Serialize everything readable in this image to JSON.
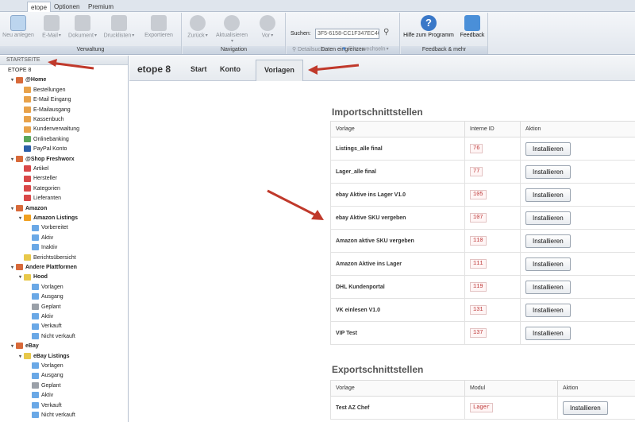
{
  "ribbon_tabs": [
    {
      "label": "etope",
      "active": true
    },
    {
      "label": "Optionen",
      "active": false
    },
    {
      "label": "Premium",
      "active": false
    }
  ],
  "ribbon": {
    "groups": {
      "verwaltung": "Verwaltung",
      "navigation": "Navigation",
      "daten": "Daten eingrenzen",
      "feedback": "Feedback & mehr"
    },
    "buttons": {
      "neu": "Neu anlegen",
      "email": "E-Mail",
      "dokument": "Dokument",
      "druck": "Drucklisten",
      "export": "Exportieren",
      "zurueck": "Zurück",
      "aktual": "Aktualisieren",
      "vor": "Vor",
      "hilfe": "Hilfe zum Programm",
      "feedback": "Feedback"
    },
    "search_label": "Suchen:",
    "search_value": "3F5-6158-CC1F347EC400",
    "detail": "Detailsuche",
    "filter": "Filter wechseln"
  },
  "sidebar": {
    "header": "STARTSEITE",
    "nodes": [
      {
        "label": "ETOPE 8",
        "depth": 0,
        "twisty": "",
        "icon": "",
        "bold": false
      },
      {
        "label": "@Home",
        "depth": 1,
        "twisty": "▾",
        "icon": "house",
        "bold": true
      },
      {
        "label": "Bestellungen",
        "depth": 2,
        "twisty": "",
        "icon": "orange",
        "bold": false
      },
      {
        "label": "E-Mail Eingang",
        "depth": 2,
        "twisty": "",
        "icon": "orange",
        "bold": false
      },
      {
        "label": "E-Mailausgang",
        "depth": 2,
        "twisty": "",
        "icon": "orange",
        "bold": false
      },
      {
        "label": "Kassenbuch",
        "depth": 2,
        "twisty": "",
        "icon": "orange",
        "bold": false
      },
      {
        "label": "Kundenverwaltung",
        "depth": 2,
        "twisty": "",
        "icon": "orange",
        "bold": false
      },
      {
        "label": "Onlinebanking",
        "depth": 2,
        "twisty": "",
        "icon": "green",
        "bold": false
      },
      {
        "label": "PayPal Konto",
        "depth": 2,
        "twisty": "",
        "icon": "pp",
        "bold": false
      },
      {
        "label": "@Shop Freshworx",
        "depth": 1,
        "twisty": "▾",
        "icon": "house",
        "bold": true
      },
      {
        "label": "Artikel",
        "depth": 2,
        "twisty": "",
        "icon": "red",
        "bold": false
      },
      {
        "label": "Hersteller",
        "depth": 2,
        "twisty": "",
        "icon": "red",
        "bold": false
      },
      {
        "label": "Kategorien",
        "depth": 2,
        "twisty": "",
        "icon": "red",
        "bold": false
      },
      {
        "label": "Lieferanten",
        "depth": 2,
        "twisty": "",
        "icon": "red",
        "bold": false
      },
      {
        "label": "Amazon",
        "depth": 1,
        "twisty": "▾",
        "icon": "house",
        "bold": true
      },
      {
        "label": "Amazon Listings",
        "depth": 2,
        "twisty": "▾",
        "icon": "amz",
        "bold": true
      },
      {
        "label": "Vorbereitet",
        "depth": 3,
        "twisty": "",
        "icon": "folder",
        "bold": false
      },
      {
        "label": "Aktiv",
        "depth": 3,
        "twisty": "",
        "icon": "folder",
        "bold": false
      },
      {
        "label": "Inaktiv",
        "depth": 3,
        "twisty": "",
        "icon": "folder",
        "bold": false
      },
      {
        "label": "Berichtsübersicht",
        "depth": 2,
        "twisty": "",
        "icon": "yellow",
        "bold": false
      },
      {
        "label": "Andere Plattformen",
        "depth": 1,
        "twisty": "▾",
        "icon": "house",
        "bold": true
      },
      {
        "label": "Hood",
        "depth": 2,
        "twisty": "▾",
        "icon": "yellow",
        "bold": true
      },
      {
        "label": "Vorlagen",
        "depth": 3,
        "twisty": "",
        "icon": "folder",
        "bold": false
      },
      {
        "label": "Ausgang",
        "depth": 3,
        "twisty": "",
        "icon": "folder",
        "bold": false
      },
      {
        "label": "Geplant",
        "depth": 3,
        "twisty": "",
        "icon": "gray",
        "bold": false
      },
      {
        "label": "Aktiv",
        "depth": 3,
        "twisty": "",
        "icon": "folder",
        "bold": false
      },
      {
        "label": "Verkauft",
        "depth": 3,
        "twisty": "",
        "icon": "folder",
        "bold": false
      },
      {
        "label": "Nicht verkauft",
        "depth": 3,
        "twisty": "",
        "icon": "folder",
        "bold": false
      },
      {
        "label": "eBay",
        "depth": 1,
        "twisty": "▾",
        "icon": "house",
        "bold": true
      },
      {
        "label": "eBay Listings",
        "depth": 2,
        "twisty": "▾",
        "icon": "yellow",
        "bold": true
      },
      {
        "label": "Vorlagen",
        "depth": 3,
        "twisty": "",
        "icon": "folder",
        "bold": false
      },
      {
        "label": "Ausgang",
        "depth": 3,
        "twisty": "",
        "icon": "folder",
        "bold": false
      },
      {
        "label": "Geplant",
        "depth": 3,
        "twisty": "",
        "icon": "gray",
        "bold": false
      },
      {
        "label": "Aktiv",
        "depth": 3,
        "twisty": "",
        "icon": "folder",
        "bold": false
      },
      {
        "label": "Verkauft",
        "depth": 3,
        "twisty": "",
        "icon": "folder",
        "bold": false
      },
      {
        "label": "Nicht verkauft",
        "depth": 3,
        "twisty": "",
        "icon": "folder",
        "bold": false
      }
    ]
  },
  "main": {
    "title": "etope 8",
    "tabs": [
      {
        "label": "Start",
        "active": false
      },
      {
        "label": "Konto",
        "active": false
      },
      {
        "label": "Vorlagen",
        "active": true
      }
    ],
    "import": {
      "title": "Importschnittstellen",
      "headers": [
        "Vorlage",
        "Interne ID",
        "Aktion"
      ],
      "rows": [
        {
          "name": "Listings_alle final",
          "id": "76"
        },
        {
          "name": "Lager_alle final",
          "id": "77"
        },
        {
          "name": "ebay Aktive ins Lager V1.0",
          "id": "105"
        },
        {
          "name": "ebay Aktive SKU vergeben",
          "id": "107"
        },
        {
          "name": "Amazon aktive SKU vergeben",
          "id": "110"
        },
        {
          "name": "Amazon Aktive ins Lager",
          "id": "111"
        },
        {
          "name": "DHL Kundenportal",
          "id": "119"
        },
        {
          "name": "VK einlesen V1.0",
          "id": "131"
        },
        {
          "name": "VIP Test",
          "id": "137"
        }
      ]
    },
    "export": {
      "title": "Exportschnittstellen",
      "headers": [
        "Vorlage",
        "Modul",
        "Aktion"
      ],
      "rows": [
        {
          "name": "Test AZ Chef",
          "modul": "Lager"
        }
      ]
    },
    "install_label": "Installieren"
  },
  "colors": {
    "annotation_arrow": "#c0392b",
    "accent": "#3a78c8"
  }
}
